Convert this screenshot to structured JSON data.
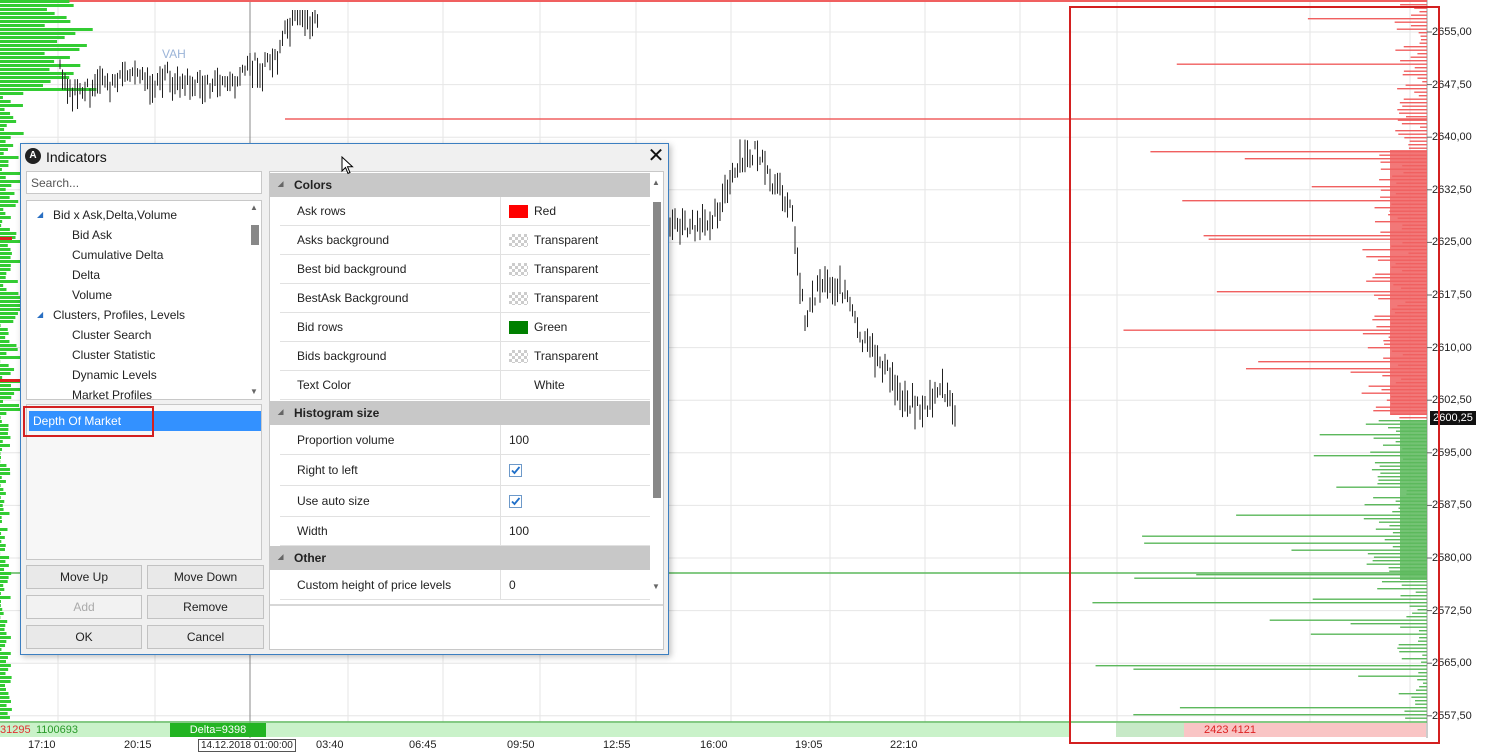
{
  "chart": {
    "price_ticks": [
      "2655,00",
      "2647,50",
      "2640,00",
      "2632,50",
      "2625,00",
      "2617,50",
      "2610,00",
      "2602,50",
      "2595,00",
      "2587,50",
      "2580,00",
      "2572,50",
      "2565,00",
      "2557,50"
    ],
    "current_price": "2600,25",
    "time_labels": [
      "17:10",
      "20:15",
      "03:40",
      "06:45",
      "09:50",
      "12:55",
      "16:00",
      "19:05",
      "22:10"
    ],
    "time_badge": "14.12.2018 01:00:00",
    "vah_label": "VAH",
    "bottom_left_red": "31295",
    "bottom_left_green": "1100693",
    "delta_label": "Delta=9398",
    "dom_bottom_values": "2423 4121",
    "colors": {
      "ask": "#f06060",
      "bid": "#5cb85c",
      "profile_green": "#33cc33",
      "highlight": "#d32020"
    }
  },
  "dialog": {
    "title": "Indicators",
    "search_placeholder": "Search...",
    "tree": [
      {
        "label": "Bid x Ask,Delta,Volume",
        "group": true
      },
      {
        "label": "Bid Ask",
        "group": false
      },
      {
        "label": "Cumulative Delta",
        "group": false
      },
      {
        "label": "Delta",
        "group": false
      },
      {
        "label": "Volume",
        "group": false
      },
      {
        "label": "Clusters, Profiles, Levels",
        "group": true
      },
      {
        "label": "Cluster Search",
        "group": false
      },
      {
        "label": "Cluster Statistic",
        "group": false
      },
      {
        "label": "Dynamic Levels",
        "group": false
      },
      {
        "label": "Market Profiles",
        "group": false
      }
    ],
    "selected_indicator": "Depth Of Market",
    "buttons": {
      "move_up": "Move Up",
      "move_down": "Move Down",
      "add": "Add",
      "remove": "Remove",
      "ok": "OK",
      "cancel": "Cancel"
    },
    "properties": {
      "cat_colors": "Colors",
      "cat_histogram": "Histogram size",
      "cat_other": "Other",
      "rows": {
        "ask_rows": {
          "name": "Ask rows",
          "value": "Red"
        },
        "asks_bg": {
          "name": "Asks background",
          "value": "Transparent"
        },
        "best_bid_bg": {
          "name": "Best bid background",
          "value": "Transparent"
        },
        "best_ask_bg": {
          "name": "BestAsk Background",
          "value": "Transparent"
        },
        "bid_rows": {
          "name": "Bid rows",
          "value": "Green"
        },
        "bids_bg": {
          "name": "Bids background",
          "value": "Transparent"
        },
        "text_color": {
          "name": "Text Color",
          "value": "White"
        },
        "proportion": {
          "name": "Proportion volume",
          "value": "100"
        },
        "rtl": {
          "name": "Right to left",
          "value": true
        },
        "auto_size": {
          "name": "Use auto size",
          "value": true
        },
        "width": {
          "name": "Width",
          "value": "100"
        },
        "custom_height": {
          "name": "Custom height of price levels",
          "value": "0"
        }
      }
    }
  }
}
